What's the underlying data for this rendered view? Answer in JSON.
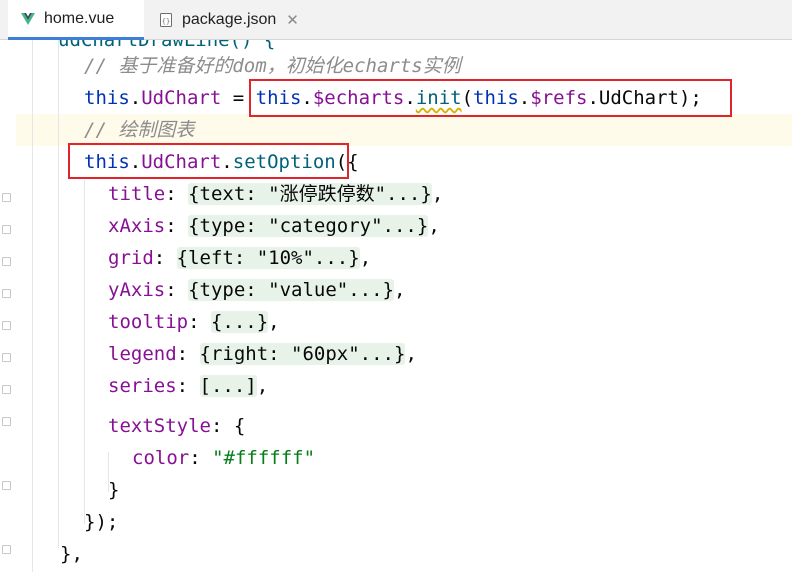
{
  "tabs": [
    {
      "label": "home.vue",
      "icon": "vue-icon",
      "active": true
    },
    {
      "label": "package.json",
      "icon": "json-file-icon",
      "active": false
    }
  ],
  "editor": {
    "top_partial": "udChartDrawLine() {",
    "comment_init": "// 基于准备好的dom，初始化echarts实例",
    "line_init": {
      "lhs_this": "this",
      "lhs_prop": "UdChart",
      "eq": " = ",
      "rhs_this": "this",
      "rhs_echarts": "$echarts",
      "rhs_init": "init",
      "rhs_this2": "this",
      "rhs_refs": "$refs",
      "rhs_tail": ".UdChart);"
    },
    "comment_draw": "// 绘制图表",
    "line_setoption": {
      "this": "this",
      "prop": "UdChart",
      "fn": "setOption",
      "tail": "({"
    },
    "options": [
      {
        "key": "title",
        "value": "{text: \"涨停跌停数\"...}"
      },
      {
        "key": "xAxis",
        "value": "{type: \"category\"...}"
      },
      {
        "key": "grid",
        "value": "{left: \"10%\"...}"
      },
      {
        "key": "yAxis",
        "value": "{type: \"value\"...}"
      },
      {
        "key": "tooltip",
        "value": "{...}"
      },
      {
        "key": "legend",
        "value": "{right: \"60px\"...}"
      },
      {
        "key": "series",
        "value": "[...]"
      }
    ],
    "textstyle_key": "textStyle",
    "textstyle_open": ": {",
    "color_key": "color",
    "color_value": "\"#ffffff\"",
    "close_brace": "}",
    "close_call": "});",
    "close_method": "},"
  },
  "colors": {
    "highlight_box": "#e0242b",
    "keyword": "#0033b3",
    "property": "#871094",
    "method": "#00627a",
    "string": "#067d17",
    "comment": "#8c8c8c"
  }
}
